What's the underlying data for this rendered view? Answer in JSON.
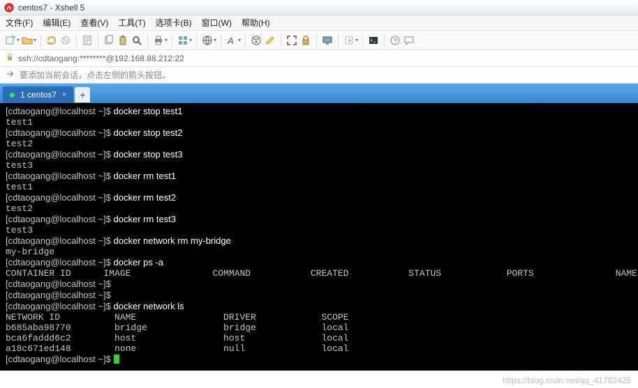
{
  "title": "centos7 - Xshell 5",
  "menu": [
    "文件(F)",
    "编辑(E)",
    "查看(V)",
    "工具(T)",
    "选项卡(B)",
    "窗口(W)",
    "帮助(H)"
  ],
  "address": "ssh://cdtaogang:********@192.168.88.212:22",
  "hint": "要添加当前会话，点击左侧的箭头按钮。",
  "tab": {
    "label": "1 centos7"
  },
  "addtab": "+",
  "watermark": "https://blog.csdn.net/qq_41782425",
  "term": {
    "prompt": "[cdtaogang@localhost ~]$",
    "lines": [
      {
        "p": true,
        "c": "docker stop test1"
      },
      {
        "o": "test1"
      },
      {
        "p": true,
        "c": "docker stop test2"
      },
      {
        "o": "test2"
      },
      {
        "p": true,
        "c": "docker stop test3"
      },
      {
        "o": "test3"
      },
      {
        "p": true,
        "c": "docker rm test1"
      },
      {
        "o": "test1"
      },
      {
        "p": true,
        "c": "docker rm test2"
      },
      {
        "o": "test2"
      },
      {
        "p": true,
        "c": "docker rm test3"
      },
      {
        "o": "test3"
      },
      {
        "p": true,
        "c": "docker network rm my-bridge"
      },
      {
        "o": "my-bridge"
      },
      {
        "p": true,
        "c": "docker ps -a"
      }
    ],
    "ps_header": [
      "CONTAINER ID",
      "IMAGE",
      "COMMAND",
      "CREATED",
      "STATUS",
      "PORTS",
      "NAMES"
    ],
    "ps_cols": [
      0,
      18,
      38,
      56,
      74,
      92,
      112
    ],
    "empty_prompts": 2,
    "net_cmd": "docker network ls",
    "net_header": [
      "NETWORK ID",
      "NAME",
      "DRIVER",
      "SCOPE"
    ],
    "net_cols": [
      0,
      20,
      40,
      58
    ],
    "net_rows": [
      [
        "b685aba98770",
        "bridge",
        "bridge",
        "local"
      ],
      [
        "bca6faddd6c2",
        "host",
        "host",
        "local"
      ],
      [
        "a18c671ed148",
        "none",
        "null",
        "local"
      ]
    ]
  }
}
